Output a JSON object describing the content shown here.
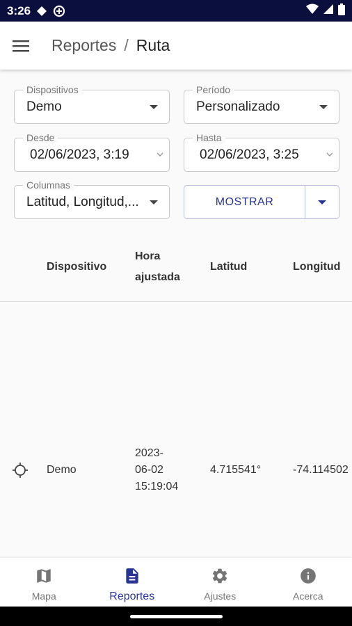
{
  "status_bar": {
    "time": "3:26",
    "icons": [
      "drive-icon",
      "vpn-icon",
      "wifi-icon",
      "signal-icon",
      "battery-icon"
    ],
    "background": "#0b0f3d"
  },
  "app_bar": {
    "menu_icon": "menu-icon",
    "breadcrumb_parent": "Reportes",
    "breadcrumb_separator": "/",
    "breadcrumb_current": "Ruta"
  },
  "filters": {
    "dispositivos": {
      "label": "Dispositivos",
      "value": "Demo"
    },
    "periodo": {
      "label": "Período",
      "value": "Personalizado"
    },
    "desde": {
      "label": "Desde",
      "value": "02/06/2023, 3:19"
    },
    "hasta": {
      "label": "Hasta",
      "value": "02/06/2023, 3:25"
    },
    "columnas": {
      "label": "Columnas",
      "value": "Latitud, Longitud,..."
    },
    "mostrar_button": "MOSTRAR"
  },
  "table": {
    "headers": [
      "Dispositivo",
      "Hora ajustada",
      "Latitud",
      "Longitud"
    ],
    "rows": [
      {
        "icon": "locate-icon",
        "dispositivo": "Demo",
        "hora_line1": "2023-",
        "hora_line2": "06-02",
        "hora_line3": "15:19:04",
        "latitud": "4.715541°",
        "longitud": "-74.114502"
      }
    ]
  },
  "bottom_nav": {
    "items": [
      {
        "label": "Mapa",
        "icon": "map-icon"
      },
      {
        "label": "Reportes",
        "icon": "document-icon",
        "active": true
      },
      {
        "label": "Ajustes",
        "icon": "gear-icon"
      },
      {
        "label": "Acerca",
        "icon": "info-icon"
      }
    ]
  },
  "colors": {
    "accent": "#283593",
    "status_bar": "#0b0f3d"
  }
}
